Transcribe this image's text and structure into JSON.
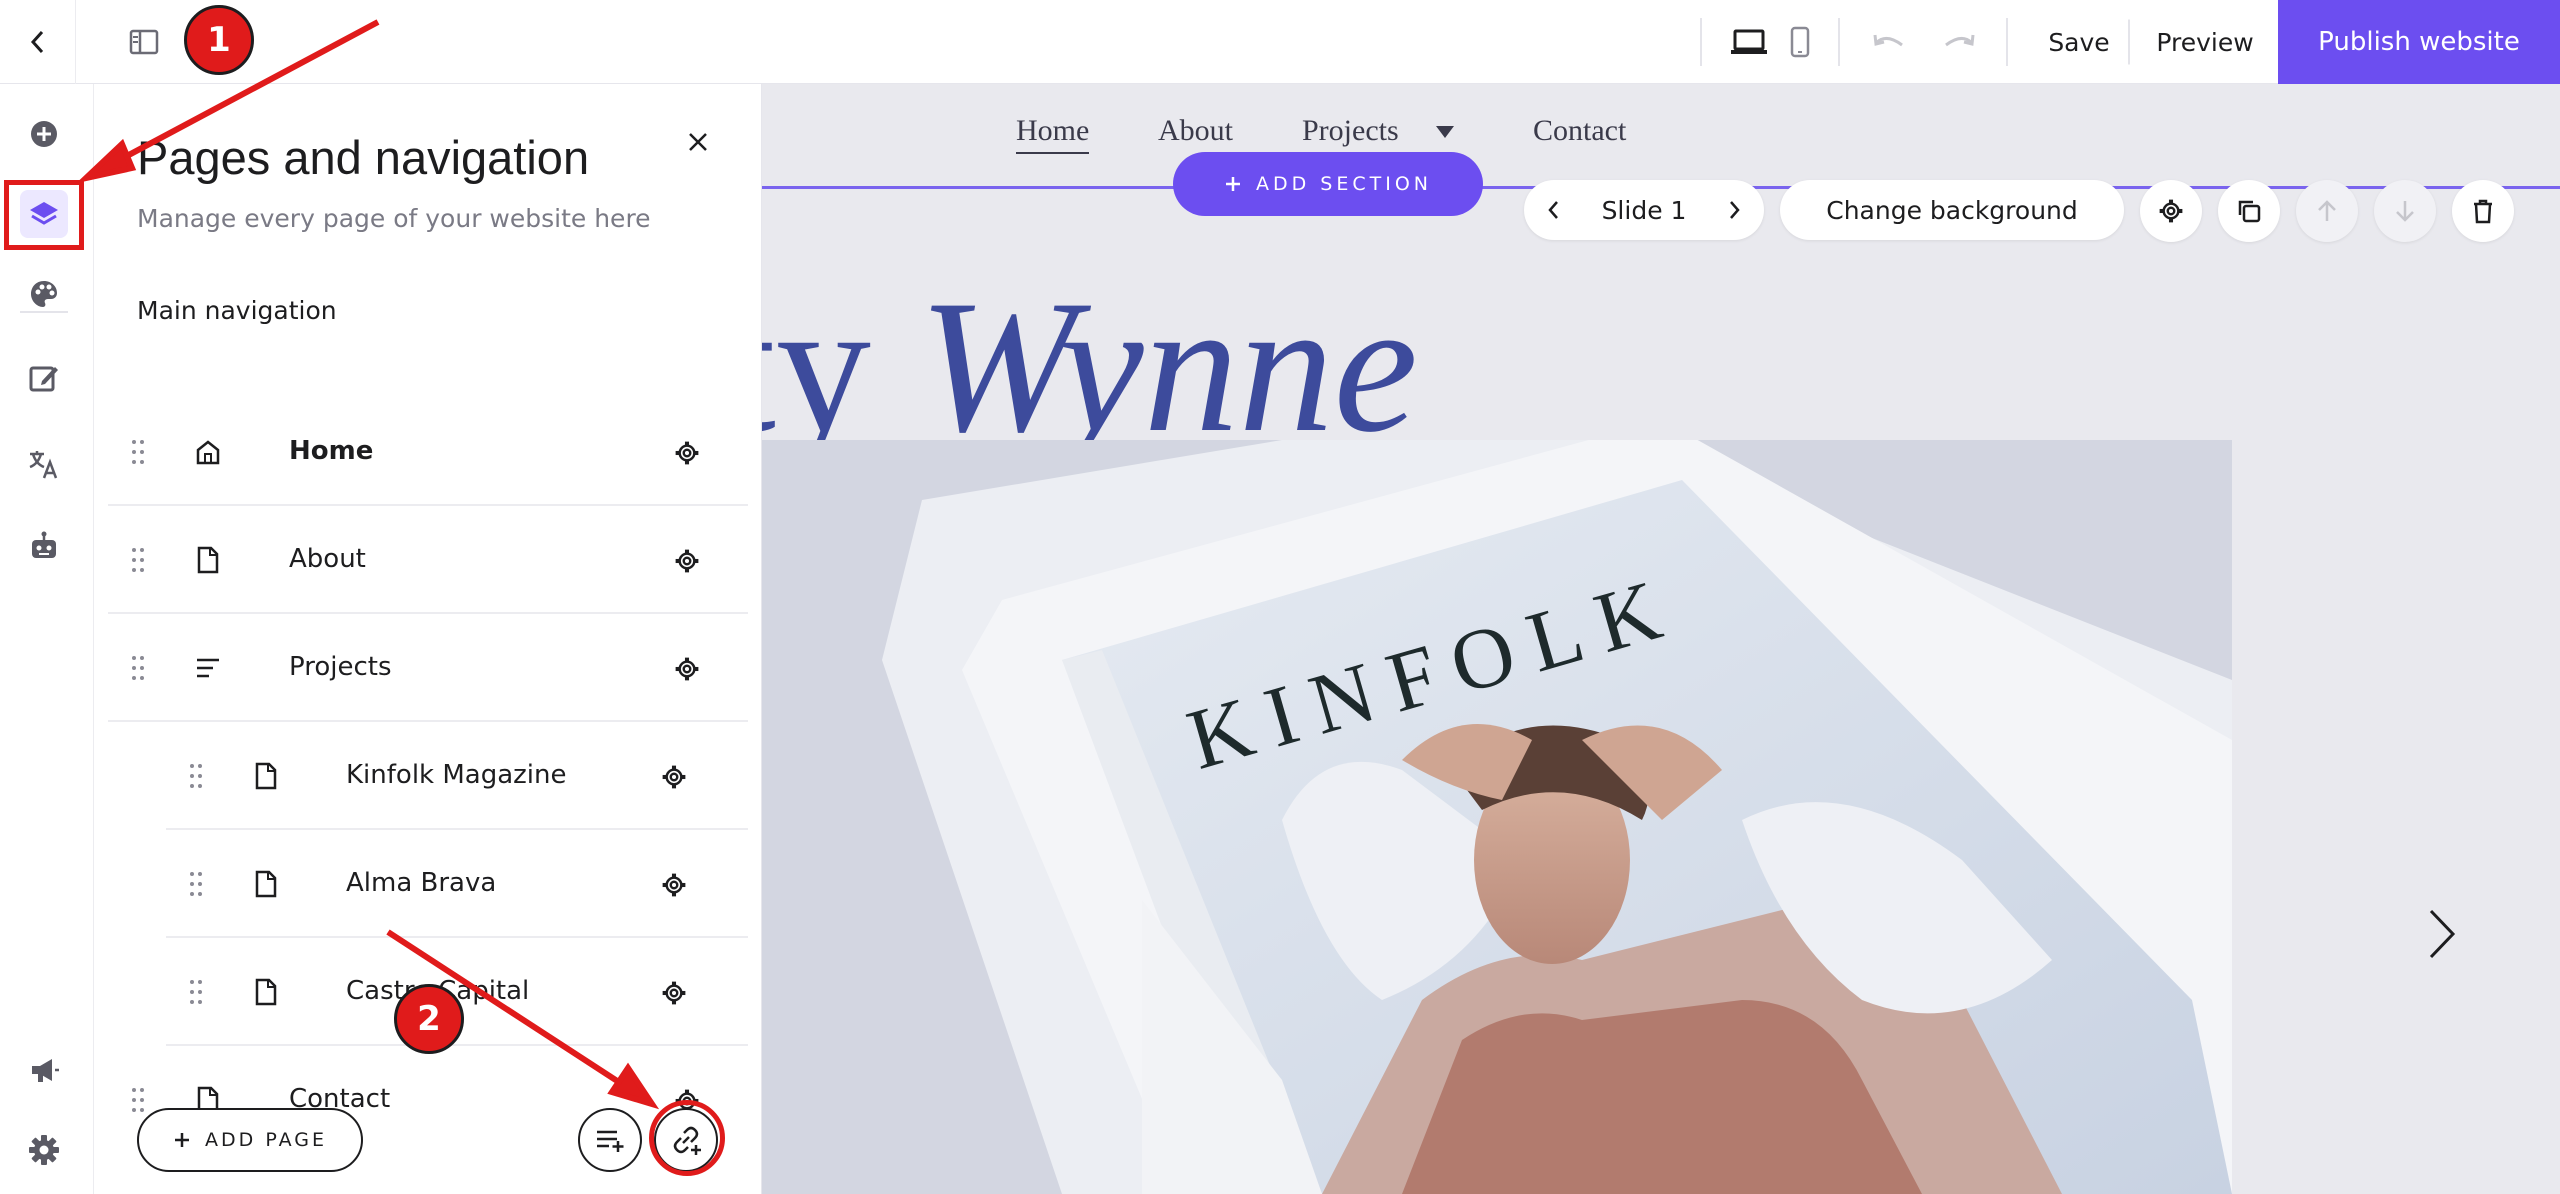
{
  "toolbar": {
    "save_label": "Save",
    "preview_label": "Preview",
    "publish_label": "Publish website"
  },
  "site": {
    "nav": [
      {
        "label": "Home",
        "active": true
      },
      {
        "label": "About",
        "active": false
      },
      {
        "label": "Projects",
        "active": false,
        "has_dropdown": true
      },
      {
        "label": "Contact",
        "active": false
      }
    ],
    "hero_title_plain": "city ",
    "hero_title_italic": "Wynne",
    "magazine_text": "KINFOLK"
  },
  "editor": {
    "add_section_label": "ADD SECTION",
    "slide_label": "Slide 1",
    "change_background_label": "Change background"
  },
  "panel": {
    "title": "Pages and navigation",
    "subtitle": "Manage every page of your website here",
    "section_label": "Main navigation",
    "items": [
      {
        "label": "Home",
        "icon": "home-icon",
        "level": 0
      },
      {
        "label": "About",
        "icon": "page-icon",
        "level": 0
      },
      {
        "label": "Projects",
        "icon": "folder-list-icon",
        "level": 0
      },
      {
        "label": "Kinfolk Magazine",
        "icon": "page-icon",
        "level": 1
      },
      {
        "label": "Alma Brava",
        "icon": "page-icon",
        "level": 1
      },
      {
        "label": "Castro Capital",
        "icon": "page-icon",
        "level": 1
      },
      {
        "label": "Contact",
        "icon": "page-icon",
        "level": 0
      }
    ],
    "add_page_label": "ADD PAGE"
  },
  "annotations": {
    "badge_1": "1",
    "badge_2": "2"
  },
  "colors": {
    "accent": "#6c4ef0",
    "annotation_red": "#e01b1b",
    "hero_blue": "#3d4b9c"
  }
}
